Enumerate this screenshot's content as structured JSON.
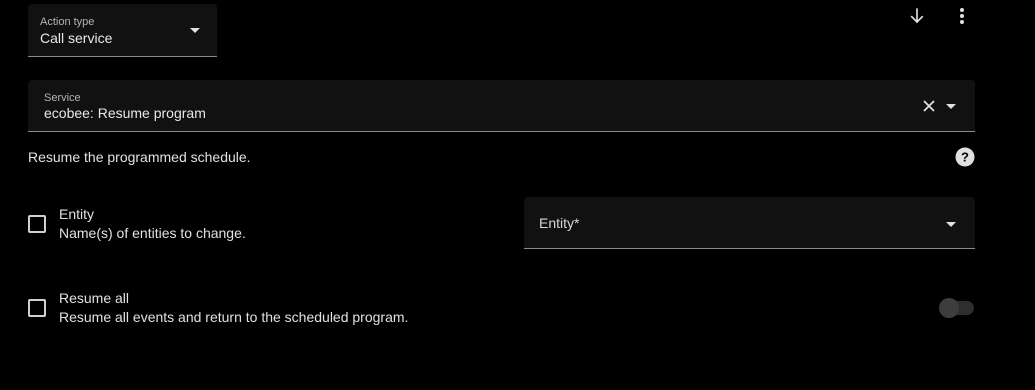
{
  "action_type": {
    "label": "Action type",
    "value": "Call service"
  },
  "service": {
    "label": "Service",
    "value": "ecobee: Resume program"
  },
  "description": "Resume the programmed schedule.",
  "fields": [
    {
      "title": "Entity",
      "description": "Name(s) of entities to change.",
      "checked": false,
      "control_label": "Entity*"
    },
    {
      "title": "Resume all",
      "description": "Resume all events and return to the scheduled program.",
      "checked": false,
      "toggle_on": false
    }
  ],
  "icons": {
    "move_down": "arrow-down-icon",
    "more": "dots-vertical-icon",
    "clear": "close-icon",
    "help": "help-circle-icon"
  },
  "colors": {
    "background": "#000000",
    "field": "#111111",
    "text": "#e1e1e1"
  }
}
